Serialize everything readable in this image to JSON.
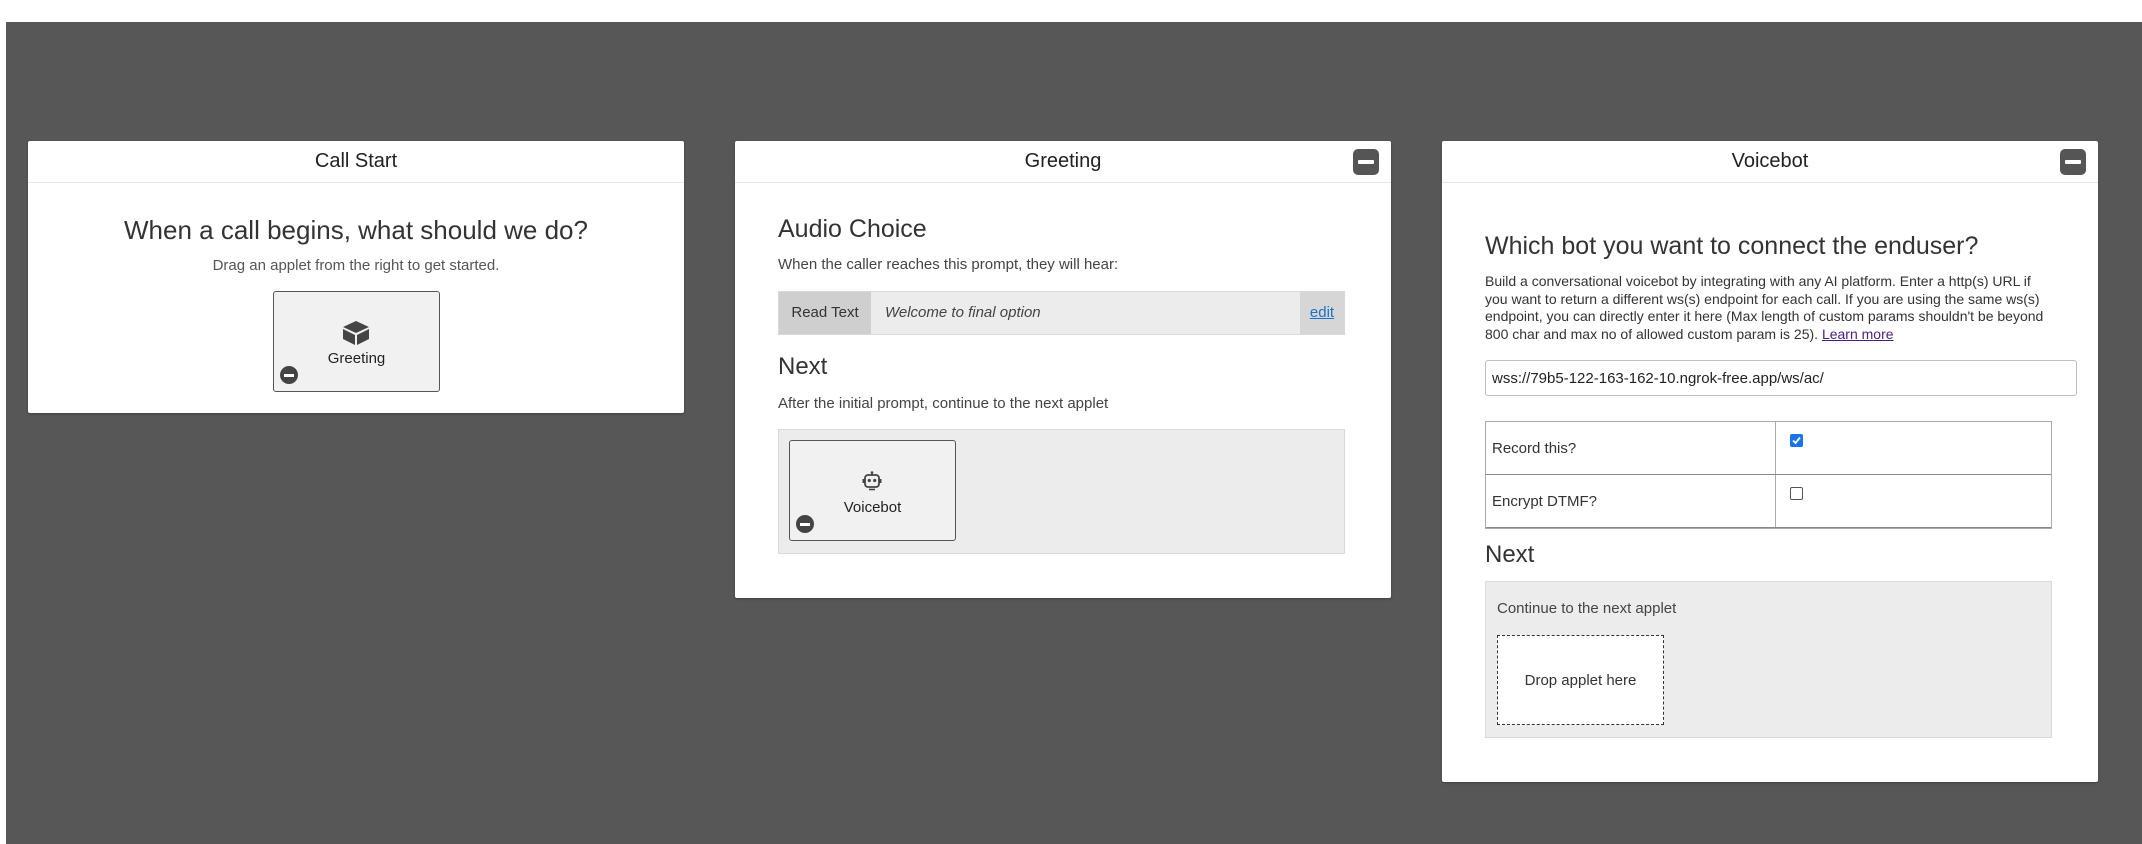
{
  "cards": {
    "call_start": {
      "title": "Call Start",
      "question": "When a call begins, what should we do?",
      "hint": "Drag an applet from the right to get started.",
      "tile": {
        "label": "Greeting",
        "icon": "cube-icon"
      }
    },
    "greeting": {
      "title": "Greeting",
      "audio_choice": {
        "heading": "Audio Choice",
        "description": "When the caller reaches this prompt, they will hear:",
        "read_text_label": "Read Text",
        "text_value": "Welcome to final option",
        "edit_link": "edit"
      },
      "next": {
        "heading": "Next",
        "description": "After the initial prompt, continue to the next applet",
        "tile": {
          "label": "Voicebot",
          "icon": "robot-icon"
        }
      }
    },
    "voicebot": {
      "title": "Voicebot",
      "question": "Which bot you want to connect the enduser?",
      "description": "Build a conversational voicebot by integrating with any AI platform. Enter a http(s) URL if you want to return a different ws(s) endpoint for each call. If you are using the same ws(s) endpoint, you can directly enter it here (Max length of custom params shouldn't be beyond 800 char and max no of allowed custom param is 25).",
      "learn_more": "Learn more",
      "url_value": "wss://79b5-122-163-162-10.ngrok-free.app/ws/ac/",
      "options": [
        {
          "label": "Record this?",
          "checked": true
        },
        {
          "label": "Encrypt DTMF?",
          "checked": false
        }
      ],
      "next": {
        "heading": "Next",
        "description": "Continue to the next applet",
        "drop_label": "Drop applet here"
      }
    }
  },
  "colors": {
    "canvas": "#575757",
    "link": "#1a73c9",
    "learn_more": "#4b1f7a",
    "checkbox": "#1a73e8"
  }
}
